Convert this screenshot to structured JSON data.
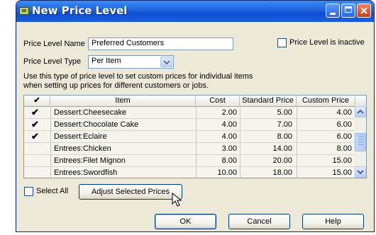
{
  "window": {
    "title": "New Price Level"
  },
  "form": {
    "name_label": "Price Level Name",
    "name_value": "Preferred Customers",
    "inactive_label": "Price Level is inactive",
    "inactive_checked": false,
    "type_label": "Price Level Type",
    "type_value": "Per Item",
    "description_line1": "Use this type of price level to set custom prices for individual items",
    "description_line2": "when setting up prices for different customers or jobs."
  },
  "table": {
    "columns": {
      "check": "✔",
      "item": "Item",
      "cost": "Cost",
      "standard": "Standard Price",
      "custom": "Custom Price"
    },
    "rows": [
      {
        "checked": "✔",
        "item": "Dessert:Cheesecake",
        "cost": "2.00",
        "standard": "5.00",
        "custom": "4.00"
      },
      {
        "checked": "✔",
        "item": "Dessert:Chocolate Cake",
        "cost": "4.00",
        "standard": "7.00",
        "custom": "6.00"
      },
      {
        "checked": "✔",
        "item": "Dessert:Eclaire",
        "cost": "4.00",
        "standard": "8.00",
        "custom": "6.00"
      },
      {
        "checked": "",
        "item": "Entrees:Chicken",
        "cost": "3.00",
        "standard": "14.00",
        "custom": "8.00"
      },
      {
        "checked": "",
        "item": "Entrees:Filet Mignon",
        "cost": "8.00",
        "standard": "20.00",
        "custom": "15.00"
      },
      {
        "checked": "",
        "item": "Entrees:Swordfish",
        "cost": "10.00",
        "standard": "18.00",
        "custom": "15.00"
      }
    ]
  },
  "actions": {
    "select_all_label": "Select All",
    "adjust_label": "Adjust Selected Prices",
    "ok_label": "OK",
    "cancel_label": "Cancel",
    "help_label": "Help"
  },
  "colors": {
    "titlebar": "#0c4fd6",
    "dialog_bg": "#ece9d8"
  },
  "icons": {
    "app": "quickbooks-icon",
    "minimize": "minimize-icon",
    "maximize": "maximize-icon",
    "close": "close-icon"
  }
}
